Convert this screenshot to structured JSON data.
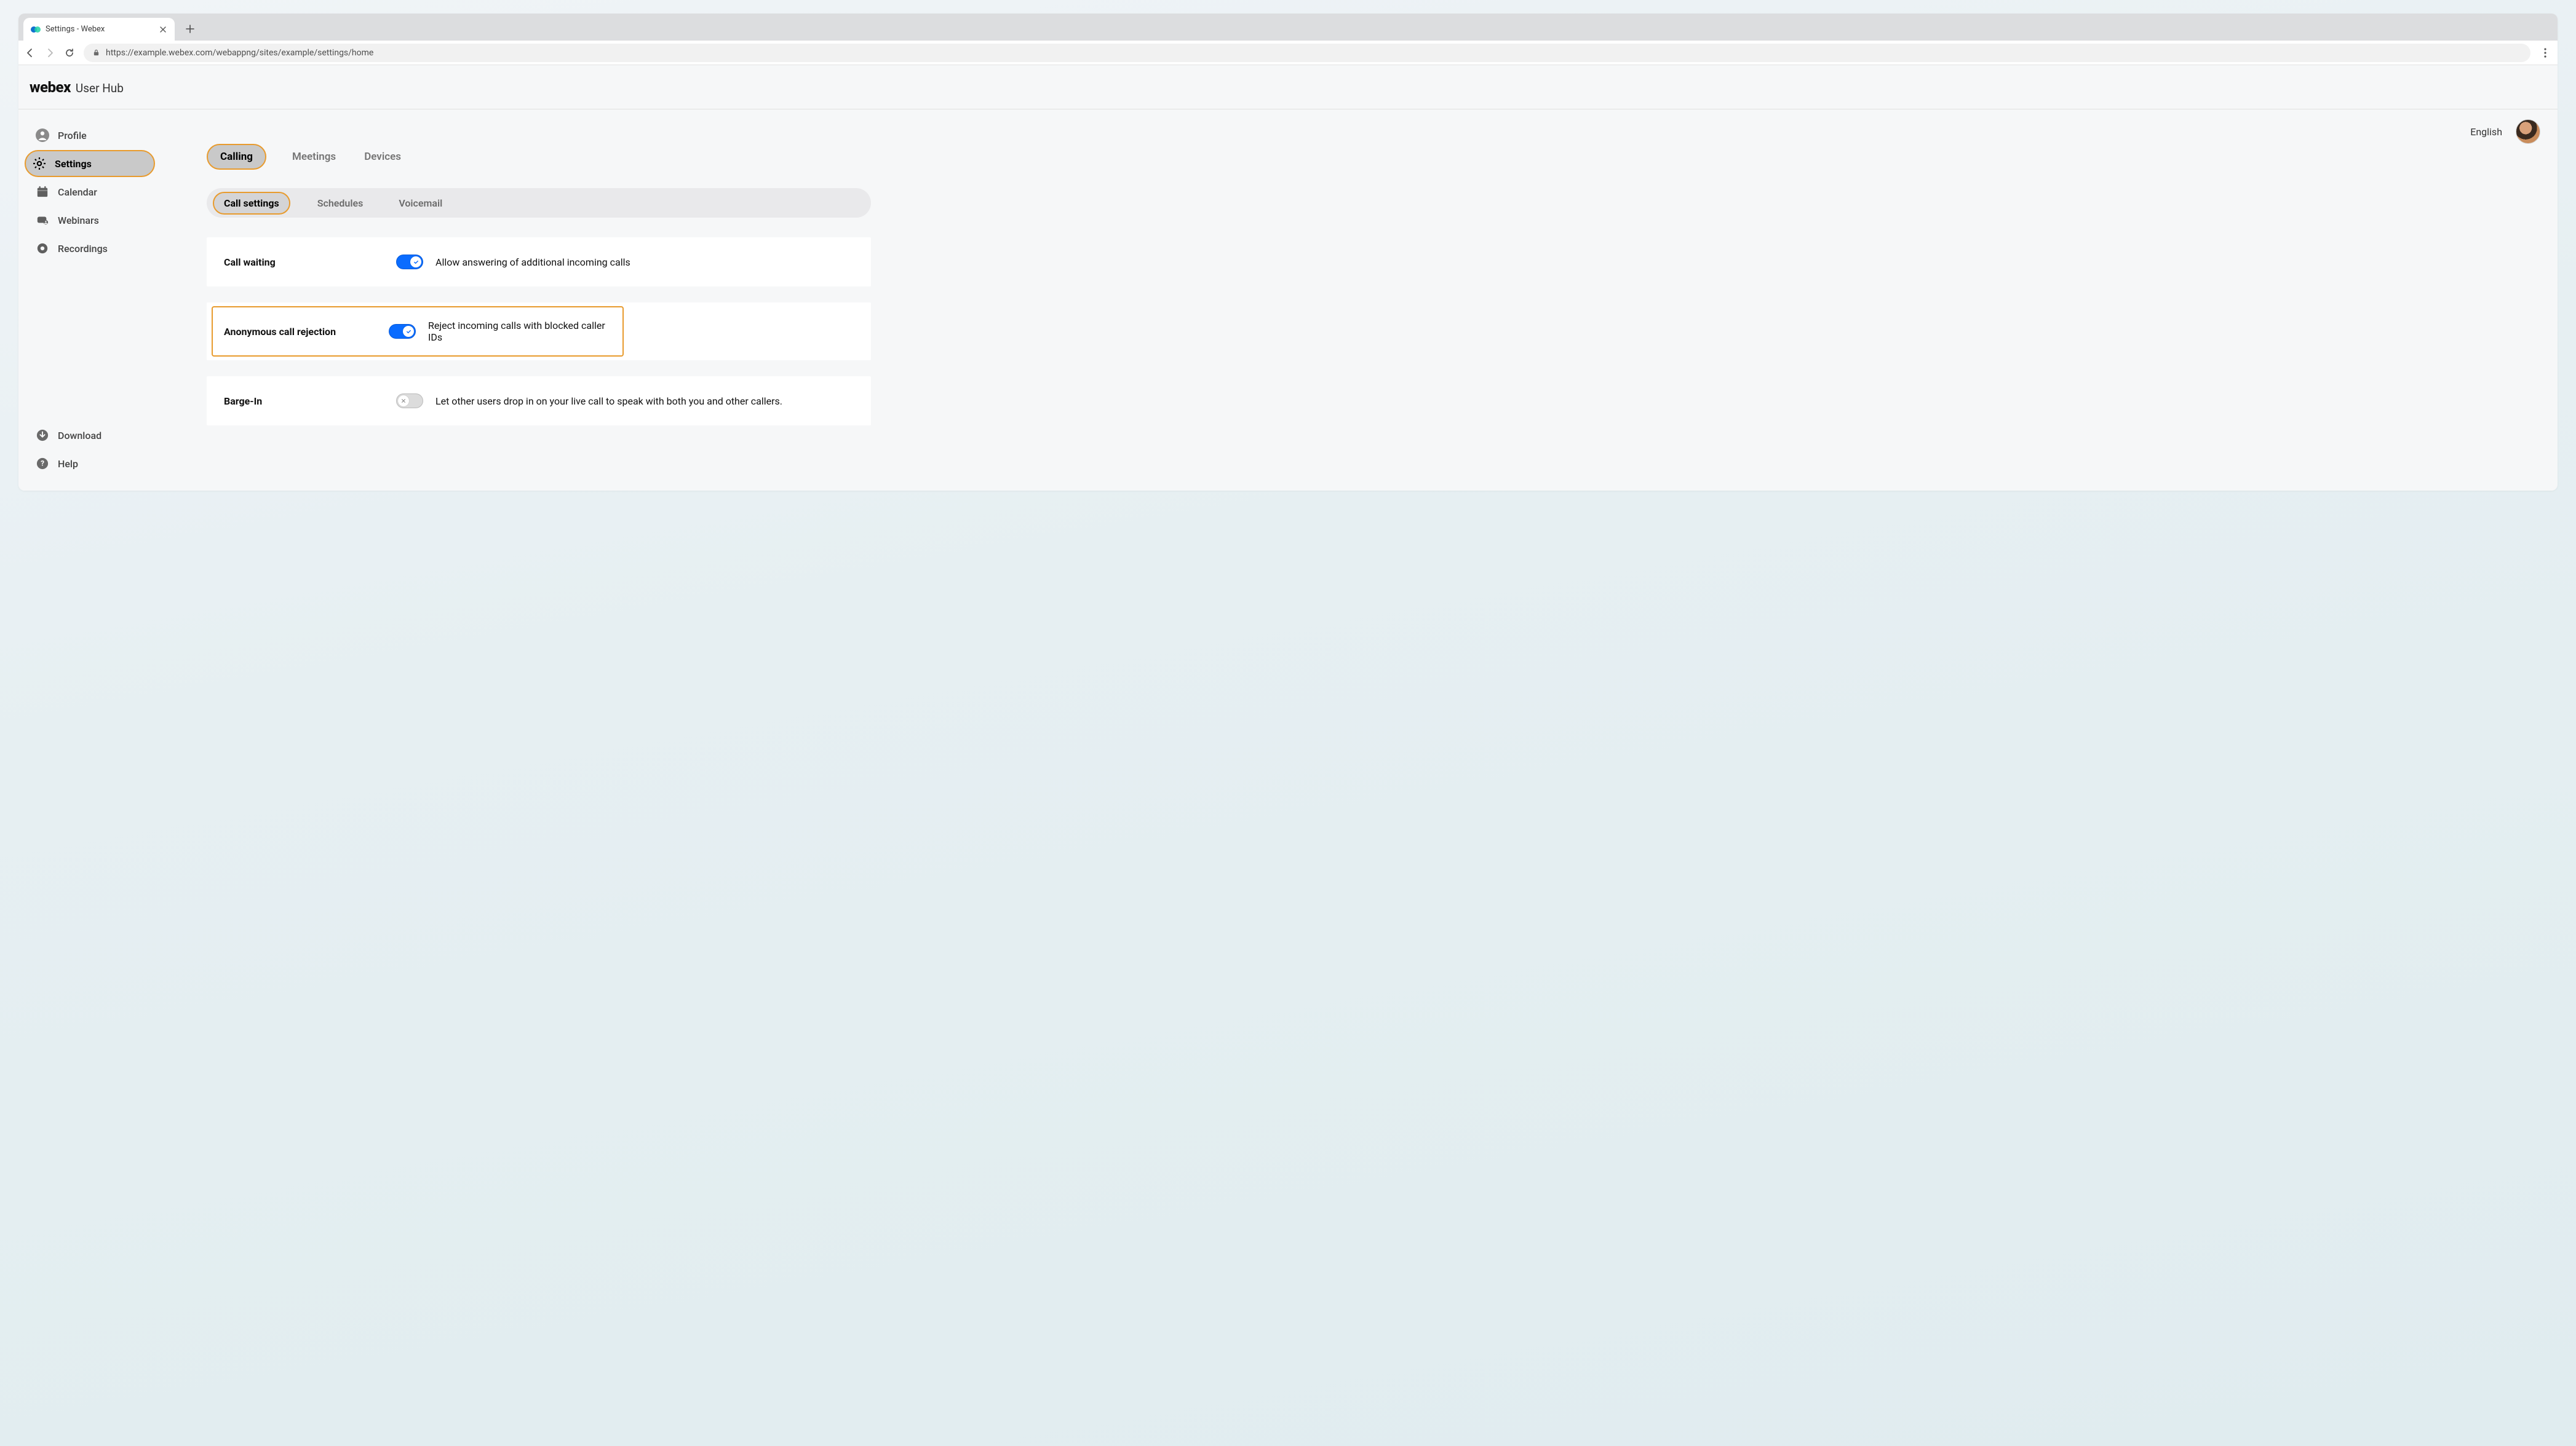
{
  "browser": {
    "tab_title": "Settings - Webex",
    "url": "https://example.webex.com/webappng/sites/example/settings/home"
  },
  "header": {
    "brand_main": "webex",
    "brand_sub": "User Hub",
    "language": "English"
  },
  "sidebar": {
    "items": [
      {
        "label": "Profile",
        "icon": "person-icon"
      },
      {
        "label": "Settings",
        "icon": "gear-icon",
        "active": true
      },
      {
        "label": "Calendar",
        "icon": "calendar-icon"
      },
      {
        "label": "Webinars",
        "icon": "webinar-icon"
      },
      {
        "label": "Recordings",
        "icon": "record-icon"
      }
    ],
    "footer": [
      {
        "label": "Download",
        "icon": "download-icon"
      },
      {
        "label": "Help",
        "icon": "help-icon"
      }
    ]
  },
  "primary_tabs": [
    {
      "label": "Calling",
      "active": true
    },
    {
      "label": "Meetings"
    },
    {
      "label": "Devices"
    }
  ],
  "sub_tabs": [
    {
      "label": "Call settings",
      "active": true
    },
    {
      "label": "Schedules"
    },
    {
      "label": "Voicemail"
    }
  ],
  "settings": [
    {
      "title": "Call waiting",
      "on": true,
      "description": "Allow answering of additional incoming calls",
      "highlighted": false
    },
    {
      "title": "Anonymous call rejection",
      "on": true,
      "description": "Reject incoming calls with blocked caller IDs",
      "highlighted": true
    },
    {
      "title": "Barge-In",
      "on": false,
      "description": "Let other users drop in on your live call to speak with both you and other callers.",
      "highlighted": false
    }
  ]
}
